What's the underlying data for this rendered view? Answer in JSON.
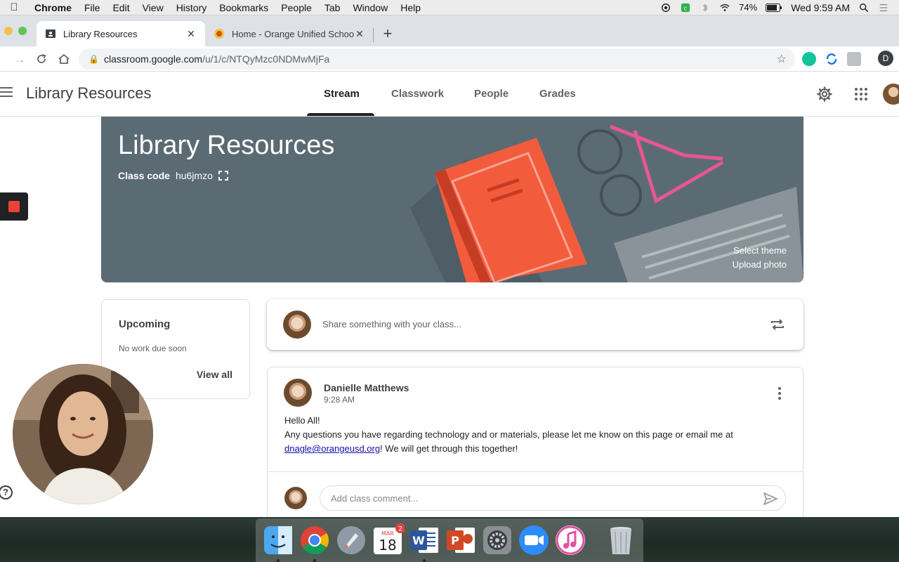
{
  "menubar": {
    "items": [
      "Chrome",
      "File",
      "Edit",
      "View",
      "History",
      "Bookmarks",
      "People",
      "Tab",
      "Window",
      "Help"
    ],
    "battery": "74%",
    "clock": "Wed 9:59 AM"
  },
  "browser": {
    "tabs": [
      {
        "title": "Library Resources",
        "active": true
      },
      {
        "title": "Home - Orange Unified School",
        "active": false
      }
    ],
    "url_host": "classroom.google.com",
    "url_path": "/u/1/c/NTQyMzc0NDMwMjFa",
    "profile_initial": "D"
  },
  "classroom": {
    "title": "Library Resources",
    "nav": [
      "Stream",
      "Classwork",
      "People",
      "Grades"
    ],
    "active_nav": "Stream"
  },
  "banner": {
    "title": "Library Resources",
    "class_code_label": "Class code",
    "class_code": "hu6jmzo",
    "select_theme": "Select theme",
    "upload_photo": "Upload photo",
    "color": "#5b6b74"
  },
  "upcoming": {
    "heading": "Upcoming",
    "empty_text": "No work due soon",
    "view_all": "View all"
  },
  "share": {
    "placeholder": "Share something with your class..."
  },
  "post": {
    "author": "Danielle Matthews",
    "time": "9:28 AM",
    "line1": "Hello All!",
    "line2": "Any questions you have regarding technology and or materials, please let me know on this page or email me at",
    "email": "dnagle@orangeusd.org",
    "line3": "! We will get through this together!",
    "comment_placeholder": "Add class comment..."
  },
  "dock": {
    "calendar_month": "MAR",
    "calendar_day": "18",
    "calendar_badge": "2",
    "apps": [
      "finder",
      "chrome",
      "launchpad",
      "calendar",
      "word",
      "powerpoint",
      "system-preferences",
      "zoom",
      "itunes",
      "trash"
    ]
  }
}
